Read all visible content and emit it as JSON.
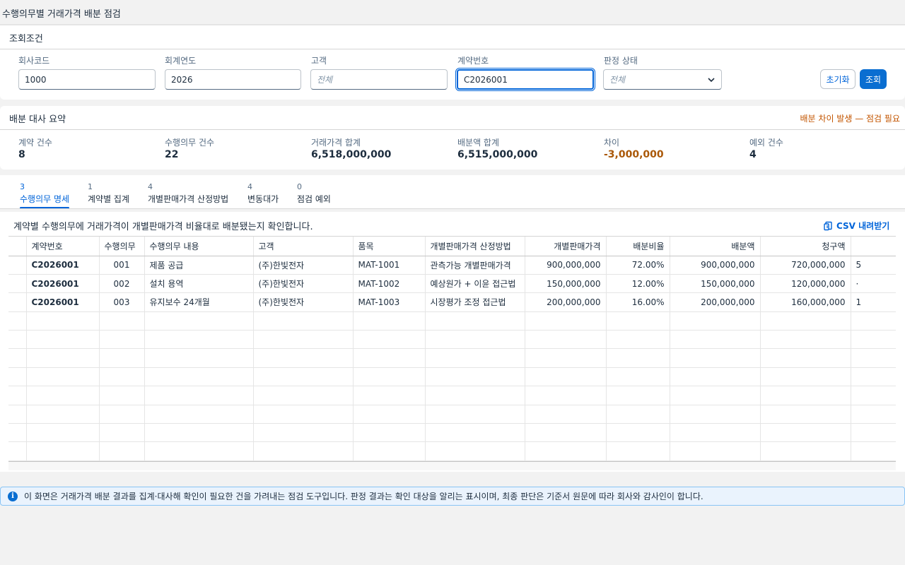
{
  "page": {
    "title": "수행의무별 거래가격 배분 점검"
  },
  "filter": {
    "title": "조회조건",
    "company_code": {
      "label": "회사코드",
      "value": "1000"
    },
    "fiscal_year": {
      "label": "회계연도",
      "value": "2026"
    },
    "customer": {
      "label": "고객",
      "placeholder": "전체"
    },
    "contract_no": {
      "label": "계약번호",
      "value": "C2026001"
    },
    "status": {
      "label": "판정 상태",
      "placeholder": "전체"
    },
    "reset_label": "초기화",
    "search_label": "조회"
  },
  "summary": {
    "title": "배분 대사 요약",
    "warning": "배분 차이 발생 — 점검 필요",
    "kpis": [
      {
        "label": "계약 건수",
        "value": "8"
      },
      {
        "label": "수행의무 건수",
        "value": "22"
      },
      {
        "label": "거래가격 합계",
        "value": "6,518,000,000"
      },
      {
        "label": "배분액 합계",
        "value": "6,515,000,000"
      },
      {
        "label": "차이",
        "value": "-3,000,000"
      },
      {
        "label": "예외 건수",
        "value": "4"
      }
    ]
  },
  "tabs": [
    {
      "count": "3",
      "label": "수행의무 명세"
    },
    {
      "count": "1",
      "label": "계약별 집계"
    },
    {
      "count": "4",
      "label": "개별판매가격 산정방법"
    },
    {
      "count": "4",
      "label": "변동대가"
    },
    {
      "count": "0",
      "label": "점검 예외"
    }
  ],
  "table": {
    "description": "계약별 수행의무에 거래가격이 개별판매가격 비율대로 배분됐는지 확인합니다.",
    "csv_label": "CSV 내려받기",
    "columns": [
      "계약번호",
      "수행의무",
      "수행의무 내용",
      "고객",
      "품목",
      "개별판매가격 산정방법",
      "개별판매가격",
      "배분비율",
      "배분액",
      "청구액",
      ""
    ],
    "rows": [
      [
        "C2026001",
        "001",
        "제품 공급",
        "(주)한빛전자",
        "MAT-1001",
        "관측가능 개별판매가격",
        "900,000,000",
        "72.00%",
        "900,000,000",
        "720,000,000",
        "5"
      ],
      [
        "C2026001",
        "002",
        "설치 용역",
        "(주)한빛전자",
        "MAT-1002",
        "예상원가 + 이윤 접근법",
        "150,000,000",
        "12.00%",
        "150,000,000",
        "120,000,000",
        "·"
      ],
      [
        "C2026001",
        "003",
        "유지보수 24개월",
        "(주)한빛전자",
        "MAT-1003",
        "시장평가 조정 접근법",
        "200,000,000",
        "16.00%",
        "200,000,000",
        "160,000,000",
        "1"
      ]
    ]
  },
  "info": {
    "text": "이 화면은 거래가격 배분 결과를 집계·대사해 확인이 필요한 건을 가려내는 점검 도구입니다. 판정 결과는 확인 대상을 알리는 표시이며, 최종 판단은 기준서 원문에 따라 회사와 감사인이 합니다."
  },
  "colors": {
    "accent": "#0064d9",
    "warning": "#c35500",
    "negative": "#aa5808"
  },
  "icons": {
    "csv": "export-icon",
    "info": "info-icon",
    "dropdown": "chevron-down-icon"
  }
}
